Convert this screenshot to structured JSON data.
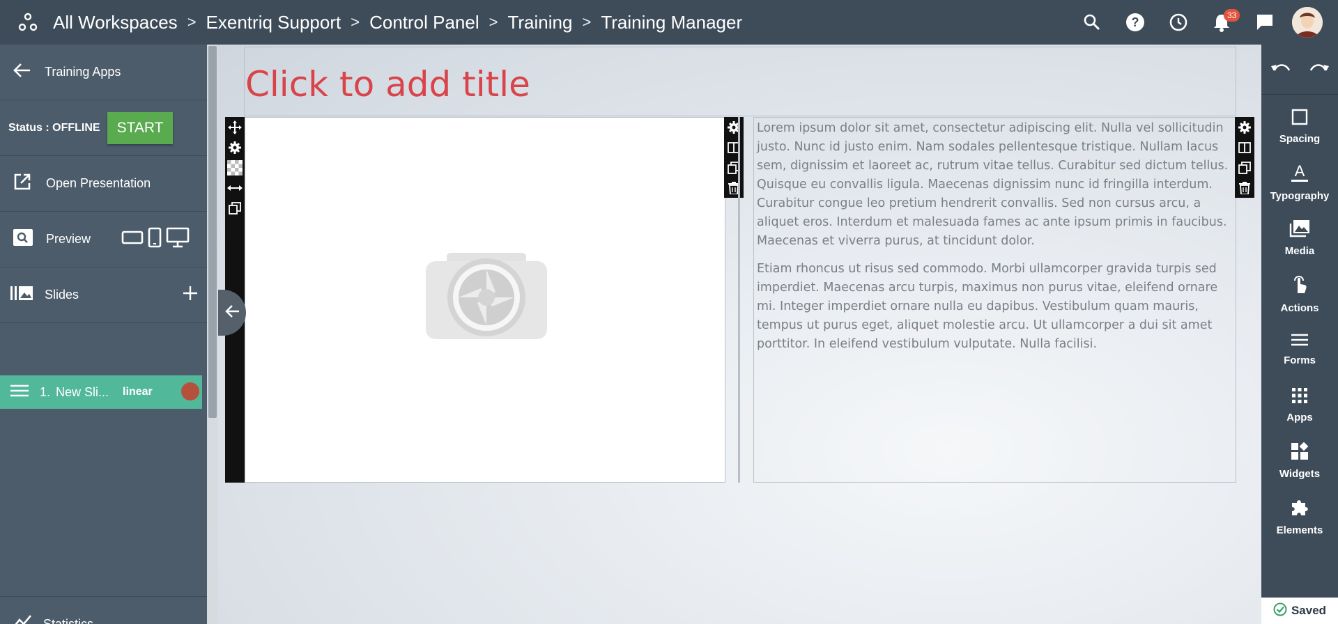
{
  "topbar": {
    "logo_icon": "workspaces-icon",
    "breadcrumbs": [
      "All Workspaces",
      "Exentriq Support",
      "Control Panel",
      "Training",
      "Training Manager"
    ],
    "notifications_count": "33"
  },
  "sidebar": {
    "back_label": "Training Apps",
    "status_label": "Status : OFFLINE",
    "start_label": "START",
    "open_presentation_label": "Open Presentation",
    "preview_label": "Preview",
    "slides_label": "Slides",
    "slide_item": {
      "number": "1.",
      "name": "New Sli...",
      "mode": "linear"
    },
    "statistics_label": "Statistics"
  },
  "canvas": {
    "title_placeholder": "Click to add title",
    "paragraphs": [
      "Lorem ipsum dolor sit amet, consectetur adipiscing elit. Nulla vel sollicitudin justo. Nunc id justo enim. Nam sodales pellentesque tristique. Nullam lacus sem, dignissim et laoreet ac, rutrum vitae tellus. Curabitur sed dictum tellus. Quisque eu convallis ligula. Maecenas dignissim nunc id fringilla interdum. Curabitur congue leo pretium hendrerit convallis. Sed non cursus arcu, a aliquet eros. Interdum et malesuada fames ac ante ipsum primis in faucibus. Maecenas et viverra purus, at tincidunt dolor.",
      "Etiam rhoncus ut risus sed commodo. Morbi ullamcorper gravida turpis sed imperdiet. Maecenas arcu turpis, maximus non purus vitae, eleifend ornare mi. Integer imperdiet ornare nulla eu dapibus. Vestibulum quam mauris, tempus ut purus eget, aliquet molestie arcu. Ut ullamcorper a dui sit amet porttitor. In eleifend vestibulum vulputate. Nulla facilisi."
    ]
  },
  "right_panel": {
    "tools": [
      "Spacing",
      "Typography",
      "Media",
      "Actions",
      "Forms",
      "Apps",
      "Widgets",
      "Elements"
    ],
    "saved_label": "Saved"
  },
  "colors": {
    "topbar_bg": "#3e4c5a",
    "sidebar_bg": "#4c5c6b",
    "start_button": "#5aaa50",
    "slide_active": "#52b89a",
    "title_placeholder": "#d9434a",
    "badge": "#e2553c"
  }
}
